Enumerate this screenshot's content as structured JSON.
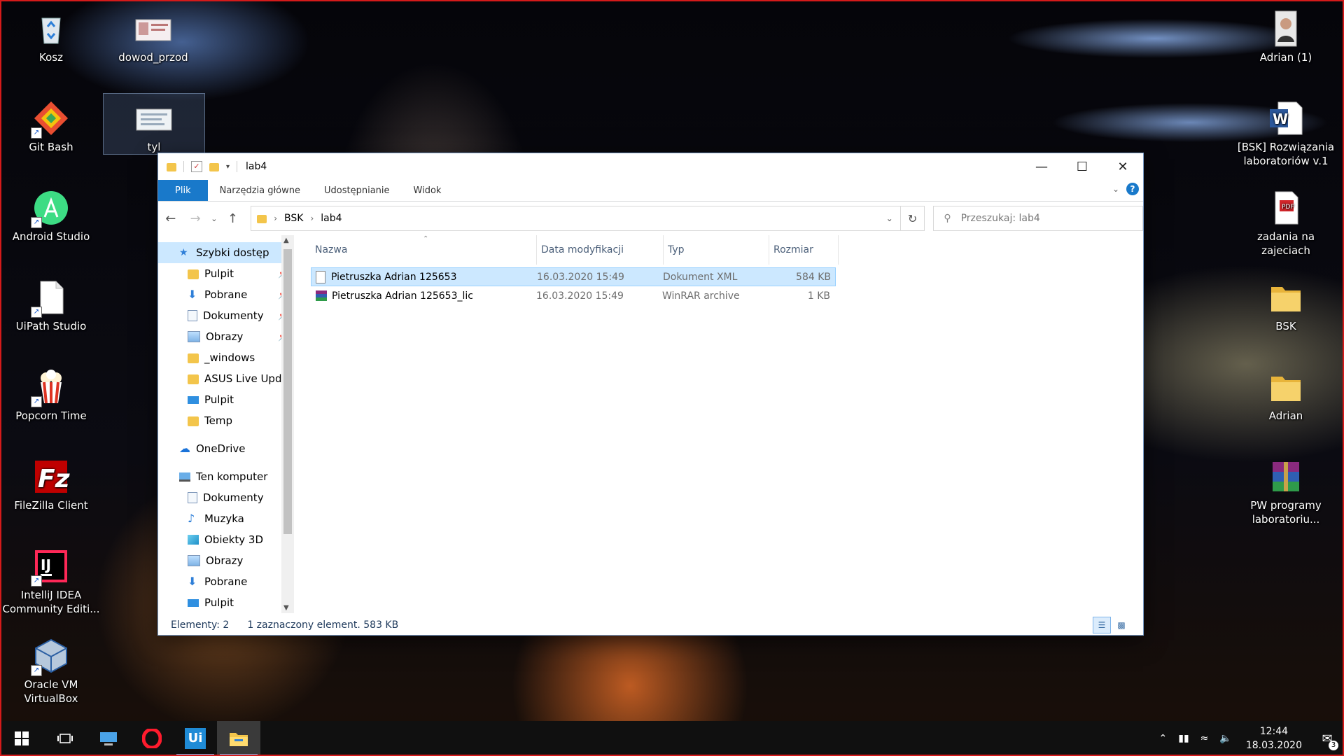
{
  "desktop": {
    "icons_left": [
      {
        "label": "Kosz",
        "icon": "recycle-bin-icon"
      },
      {
        "label": "Git Bash",
        "icon": "git-bash-icon"
      },
      {
        "label": "Android Studio",
        "icon": "android-studio-icon"
      },
      {
        "label": "UiPath Studio",
        "icon": "document-icon"
      },
      {
        "label": "Popcorn Time",
        "icon": "popcorn-icon"
      },
      {
        "label": "FileZilla Client",
        "icon": "filezilla-icon"
      },
      {
        "label": "IntelliJ IDEA Community Editi...",
        "icon": "intellij-icon"
      },
      {
        "label": "Oracle VM VirtualBox",
        "icon": "virtualbox-icon"
      }
    ],
    "icons_second": [
      {
        "label": "dowod_przod",
        "icon": "id-card-image-icon"
      },
      {
        "label": "tyl",
        "icon": "id-card-image-icon"
      }
    ],
    "icons_right": [
      {
        "label": "Adrian (1)",
        "icon": "photo-icon"
      },
      {
        "label": "[BSK] Rozwiązania laboratoriów v.1",
        "icon": "word-icon"
      },
      {
        "label": "zadania na zajeciach",
        "icon": "pdf-icon"
      },
      {
        "label": "BSK",
        "icon": "folder-icon"
      },
      {
        "label": "Adrian",
        "icon": "folder-icon"
      },
      {
        "label": "PW programy laboratoriu...",
        "icon": "winrar-icon"
      }
    ]
  },
  "explorer": {
    "title": "lab4",
    "ribbon_tabs": [
      "Plik",
      "Narzędzia główne",
      "Udostępnianie",
      "Widok"
    ],
    "breadcrumb": [
      "BSK",
      "lab4"
    ],
    "search_placeholder": "Przeszukaj: lab4",
    "nav": {
      "quick_access": "Szybki dostęp",
      "quick_items": [
        {
          "label": "Pulpit",
          "pinned": true,
          "icon": "desktop-icon"
        },
        {
          "label": "Pobrane",
          "pinned": true,
          "icon": "download-icon"
        },
        {
          "label": "Dokumenty",
          "pinned": true,
          "icon": "documents-icon"
        },
        {
          "label": "Obrazy",
          "pinned": true,
          "icon": "pictures-icon"
        },
        {
          "label": "_windows",
          "pinned": false,
          "icon": "folder-icon"
        },
        {
          "label": "ASUS Live Updat",
          "pinned": false,
          "icon": "folder-icon"
        },
        {
          "label": "Pulpit",
          "pinned": false,
          "icon": "desktop-icon"
        },
        {
          "label": "Temp",
          "pinned": false,
          "icon": "folder-icon"
        }
      ],
      "onedrive": "OneDrive",
      "this_pc": "Ten komputer",
      "pc_items": [
        {
          "label": "Dokumenty",
          "icon": "documents-icon"
        },
        {
          "label": "Muzyka",
          "icon": "music-icon"
        },
        {
          "label": "Obiekty 3D",
          "icon": "3d-objects-icon"
        },
        {
          "label": "Obrazy",
          "icon": "pictures-icon"
        },
        {
          "label": "Pobrane",
          "icon": "download-icon"
        },
        {
          "label": "Pulpit",
          "icon": "desktop-icon"
        }
      ]
    },
    "columns": [
      "Nazwa",
      "Data modyfikacji",
      "Typ",
      "Rozmiar"
    ],
    "files": [
      {
        "name": "Pietruszka Adrian 125653",
        "date": "16.03.2020 15:49",
        "type": "Dokument XML",
        "size": "584 KB",
        "selected": true
      },
      {
        "name": "Pietruszka Adrian 125653_lic",
        "date": "16.03.2020 15:49",
        "type": "WinRAR archive",
        "size": "1 KB",
        "selected": false
      }
    ],
    "status": {
      "count": "Elementy: 2",
      "selection": "1 zaznaczony element. 583 KB"
    }
  },
  "taskbar": {
    "clock_time": "12:44",
    "clock_date": "18.03.2020",
    "notifications": "3"
  }
}
